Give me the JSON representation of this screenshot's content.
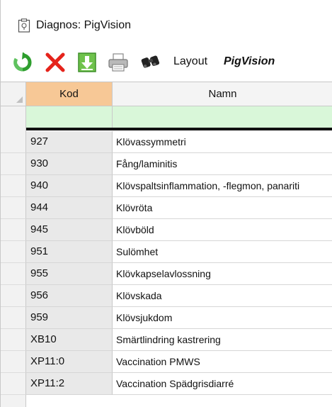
{
  "window": {
    "title": "Diagnos: PigVision"
  },
  "toolbar": {
    "buttons": [
      "refresh-icon",
      "delete-icon",
      "download-icon",
      "print-icon",
      "binoculars-icon"
    ],
    "layout_label": "Layout",
    "layout_value": "PigVision"
  },
  "grid": {
    "columns": [
      "Kod",
      "Namn"
    ],
    "rows": [
      {
        "kod": "927",
        "namn": "Klövassymmetri"
      },
      {
        "kod": "930",
        "namn": "Fång/laminitis"
      },
      {
        "kod": "940",
        "namn": "Klövspaltsinflammation, -flegmon, panariti"
      },
      {
        "kod": "944",
        "namn": "Klövröta"
      },
      {
        "kod": "945",
        "namn": "Klövböld"
      },
      {
        "kod": "951",
        "namn": "Sulömhet"
      },
      {
        "kod": "955",
        "namn": "Klövkapselavlossning"
      },
      {
        "kod": "956",
        "namn": "Klövskada"
      },
      {
        "kod": "959",
        "namn": "Klövsjukdom"
      },
      {
        "kod": "XB10",
        "namn": "Smärtlindring kastrering"
      },
      {
        "kod": "XP11:0",
        "namn": "Vaccination PMWS"
      },
      {
        "kod": "XP11:2",
        "namn": "Vaccination Spädgrisdiarré"
      }
    ]
  },
  "colors": {
    "kod_header": "#f7c896",
    "filter_row": "#d9f7d9",
    "kod_cells": "#e9e9e9"
  }
}
